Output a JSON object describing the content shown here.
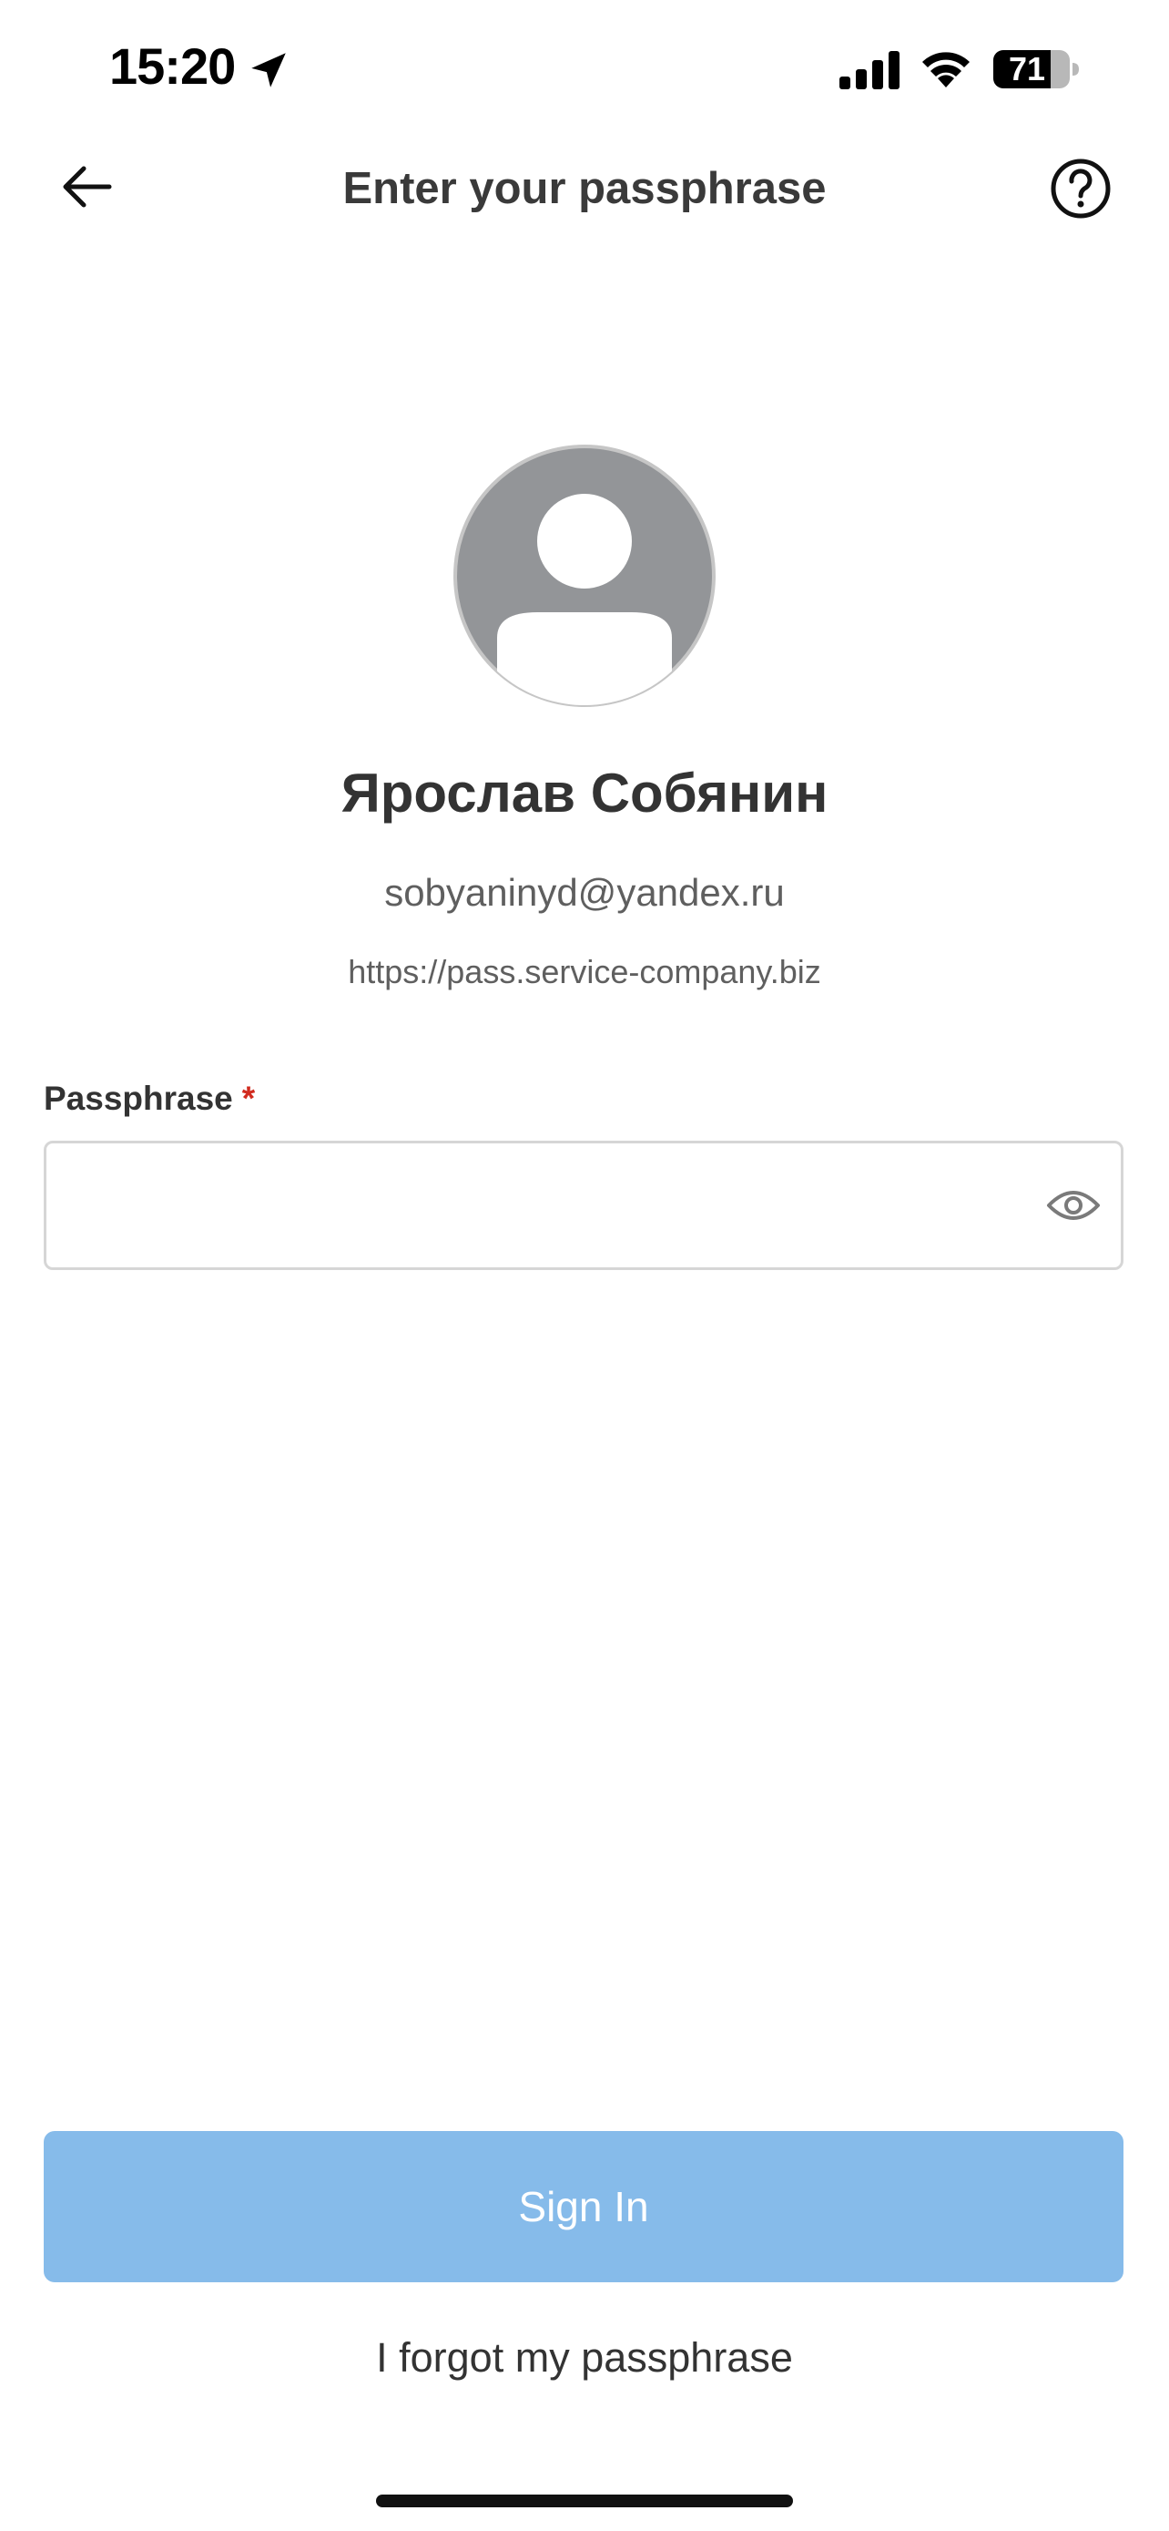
{
  "status_bar": {
    "time": "15:20",
    "battery_level": "71",
    "icons": [
      "location-arrow-icon",
      "cellular-signal-icon",
      "wifi-icon",
      "battery-icon"
    ]
  },
  "nav": {
    "title": "Enter your passphrase",
    "back_icon": "arrow-left-icon",
    "help_icon": "question-circle-icon"
  },
  "profile": {
    "name": "Ярослав Собянин",
    "email": "sobyaninyd@yandex.ru",
    "server_url": "https://pass.service-company.biz",
    "avatar_icon": "default-user-avatar-icon"
  },
  "form": {
    "passphrase_label": "Passphrase",
    "required_mark": "*",
    "passphrase_value": "",
    "visibility_icon": "eye-icon"
  },
  "actions": {
    "sign_in_label": "Sign In",
    "forgot_label": "I forgot my passphrase"
  },
  "colors": {
    "primary_disabled": "#86bbea",
    "required": "#d12b1f",
    "avatar_bg": "#939598",
    "text": "#333333",
    "secondary_text": "#5f5f5f"
  }
}
